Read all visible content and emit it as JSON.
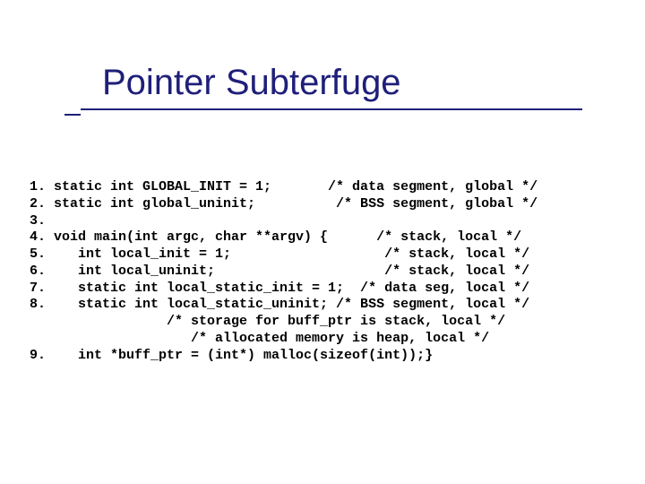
{
  "title": "Pointer Subterfuge",
  "lines": {
    "l01": " 1. static int GLOBAL_INIT = 1;       /* data segment, global */",
    "l02": " 2. static int global_uninit;          /* BSS segment, global */",
    "l03": " 3.",
    "l04": " 4. void main(int argc, char **argv) {      /* stack, local */",
    "l05": " 5.    int local_init = 1;                   /* stack, local */",
    "l06": " 6.    int local_uninit;                     /* stack, local */",
    "l07": " 7.    static int local_static_init = 1;  /* data seg, local */",
    "l08": " 8.    static int local_static_uninit; /* BSS segment, local */",
    "l09": "                  /* storage for buff_ptr is stack, local */",
    "l10": "                     /* allocated memory is heap, local */",
    "l11": " 9.    int *buff_ptr = (int*) malloc(sizeof(int));}"
  }
}
